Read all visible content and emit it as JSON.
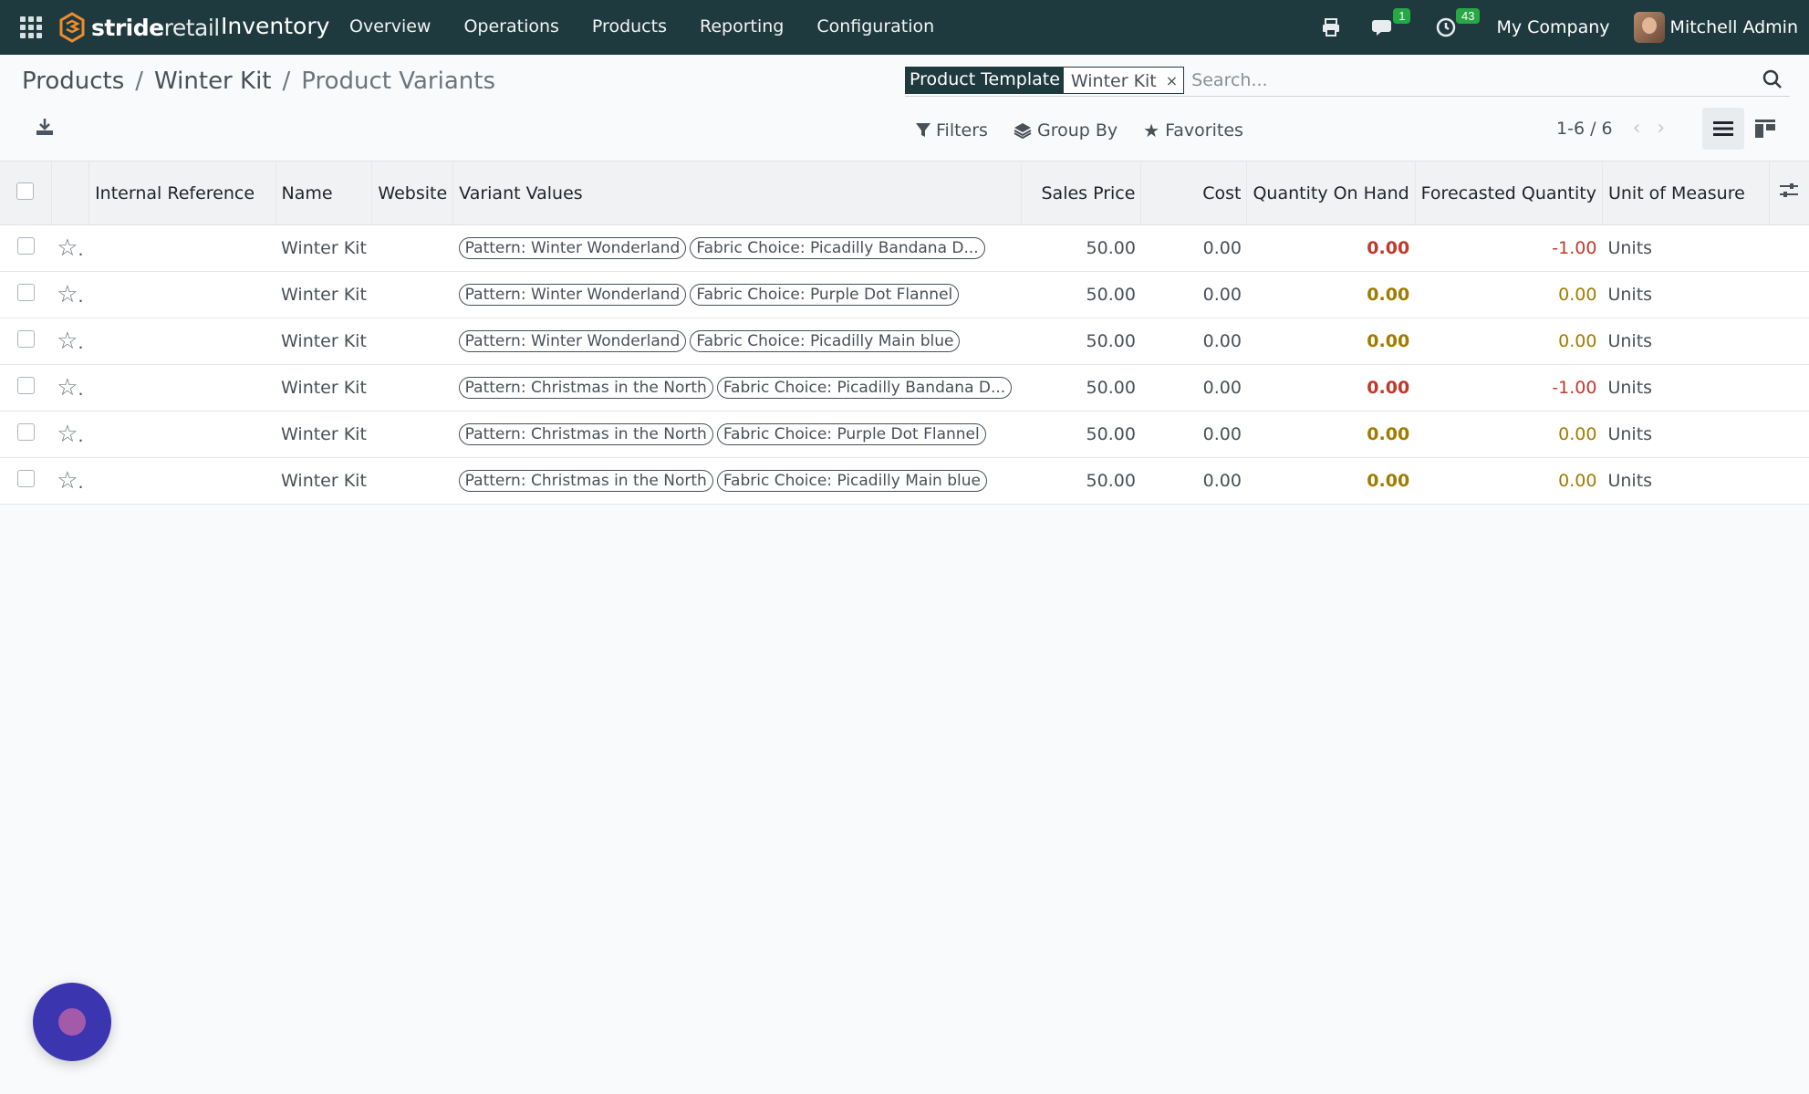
{
  "navbar": {
    "brand_left": "stride",
    "brand_right": "retail",
    "app_name": "Inventory",
    "menu": [
      "Overview",
      "Operations",
      "Products",
      "Reporting",
      "Configuration"
    ],
    "messages_badge": "1",
    "activities_badge": "43",
    "company": "My Company",
    "user": "Mitchell Admin"
  },
  "breadcrumb": {
    "items": [
      "Products",
      "Winter Kit",
      "Product Variants"
    ],
    "separator": "/"
  },
  "search": {
    "facet_label": "Product Template",
    "facet_value": "Winter Kit",
    "facet_remove": "×",
    "placeholder": "Search..."
  },
  "toolbar": {
    "filters": "Filters",
    "group_by": "Group By",
    "favorites": "Favorites",
    "pager": "1-6 / 6"
  },
  "table": {
    "headers": {
      "internal_reference": "Internal Reference",
      "name": "Name",
      "website": "Website",
      "variant_values": "Variant Values",
      "sales_price": "Sales Price",
      "cost": "Cost",
      "qty_on_hand": "Quantity On Hand",
      "forecasted_qty": "Forecasted Quantity",
      "uom": "Unit of Measure"
    },
    "rows": [
      {
        "name": "Winter Kit",
        "pattern": "Pattern: Winter Wonderland",
        "fabric": "Fabric Choice: Picadilly Bandana D...",
        "sales_price": "50.00",
        "cost": "0.00",
        "qty_on_hand": "0.00",
        "forecast": "-1.00",
        "uom": "Units",
        "qty_status": "red",
        "forecast_status": "negative"
      },
      {
        "name": "Winter Kit",
        "pattern": "Pattern: Winter Wonderland",
        "fabric": "Fabric Choice: Purple Dot Flannel",
        "sales_price": "50.00",
        "cost": "0.00",
        "qty_on_hand": "0.00",
        "forecast": "0.00",
        "uom": "Units",
        "qty_status": "warning",
        "forecast_status": "warning"
      },
      {
        "name": "Winter Kit",
        "pattern": "Pattern: Winter Wonderland",
        "fabric": "Fabric Choice: Picadilly Main blue",
        "sales_price": "50.00",
        "cost": "0.00",
        "qty_on_hand": "0.00",
        "forecast": "0.00",
        "uom": "Units",
        "qty_status": "warning",
        "forecast_status": "warning"
      },
      {
        "name": "Winter Kit",
        "pattern": "Pattern: Christmas in the North",
        "fabric": "Fabric Choice: Picadilly Bandana D...",
        "sales_price": "50.00",
        "cost": "0.00",
        "qty_on_hand": "0.00",
        "forecast": "-1.00",
        "uom": "Units",
        "qty_status": "red",
        "forecast_status": "negative"
      },
      {
        "name": "Winter Kit",
        "pattern": "Pattern: Christmas in the North",
        "fabric": "Fabric Choice: Purple Dot Flannel",
        "sales_price": "50.00",
        "cost": "0.00",
        "qty_on_hand": "0.00",
        "forecast": "0.00",
        "uom": "Units",
        "qty_status": "warning",
        "forecast_status": "warning"
      },
      {
        "name": "Winter Kit",
        "pattern": "Pattern: Christmas in the North",
        "fabric": "Fabric Choice: Picadilly Main blue",
        "sales_price": "50.00",
        "cost": "0.00",
        "qty_on_hand": "0.00",
        "forecast": "0.00",
        "uom": "Units",
        "qty_status": "warning",
        "forecast_status": "warning"
      }
    ]
  },
  "colors": {
    "navbar_bg": "#1f3a3f",
    "danger": "#c0392b",
    "warning": "#a07b00",
    "chat_bubble": "#3b35b0"
  },
  "icons": {
    "apps": "apps-grid-icon",
    "print": "printer-icon",
    "messages": "chat-icon",
    "activities": "clock-icon",
    "search": "search-icon",
    "download": "download-icon",
    "filters": "filter-icon",
    "group_by": "layers-icon",
    "favorites": "star-icon",
    "list_view": "list-view-icon",
    "kanban_view": "kanban-view-icon",
    "optional_columns": "sliders-icon"
  }
}
